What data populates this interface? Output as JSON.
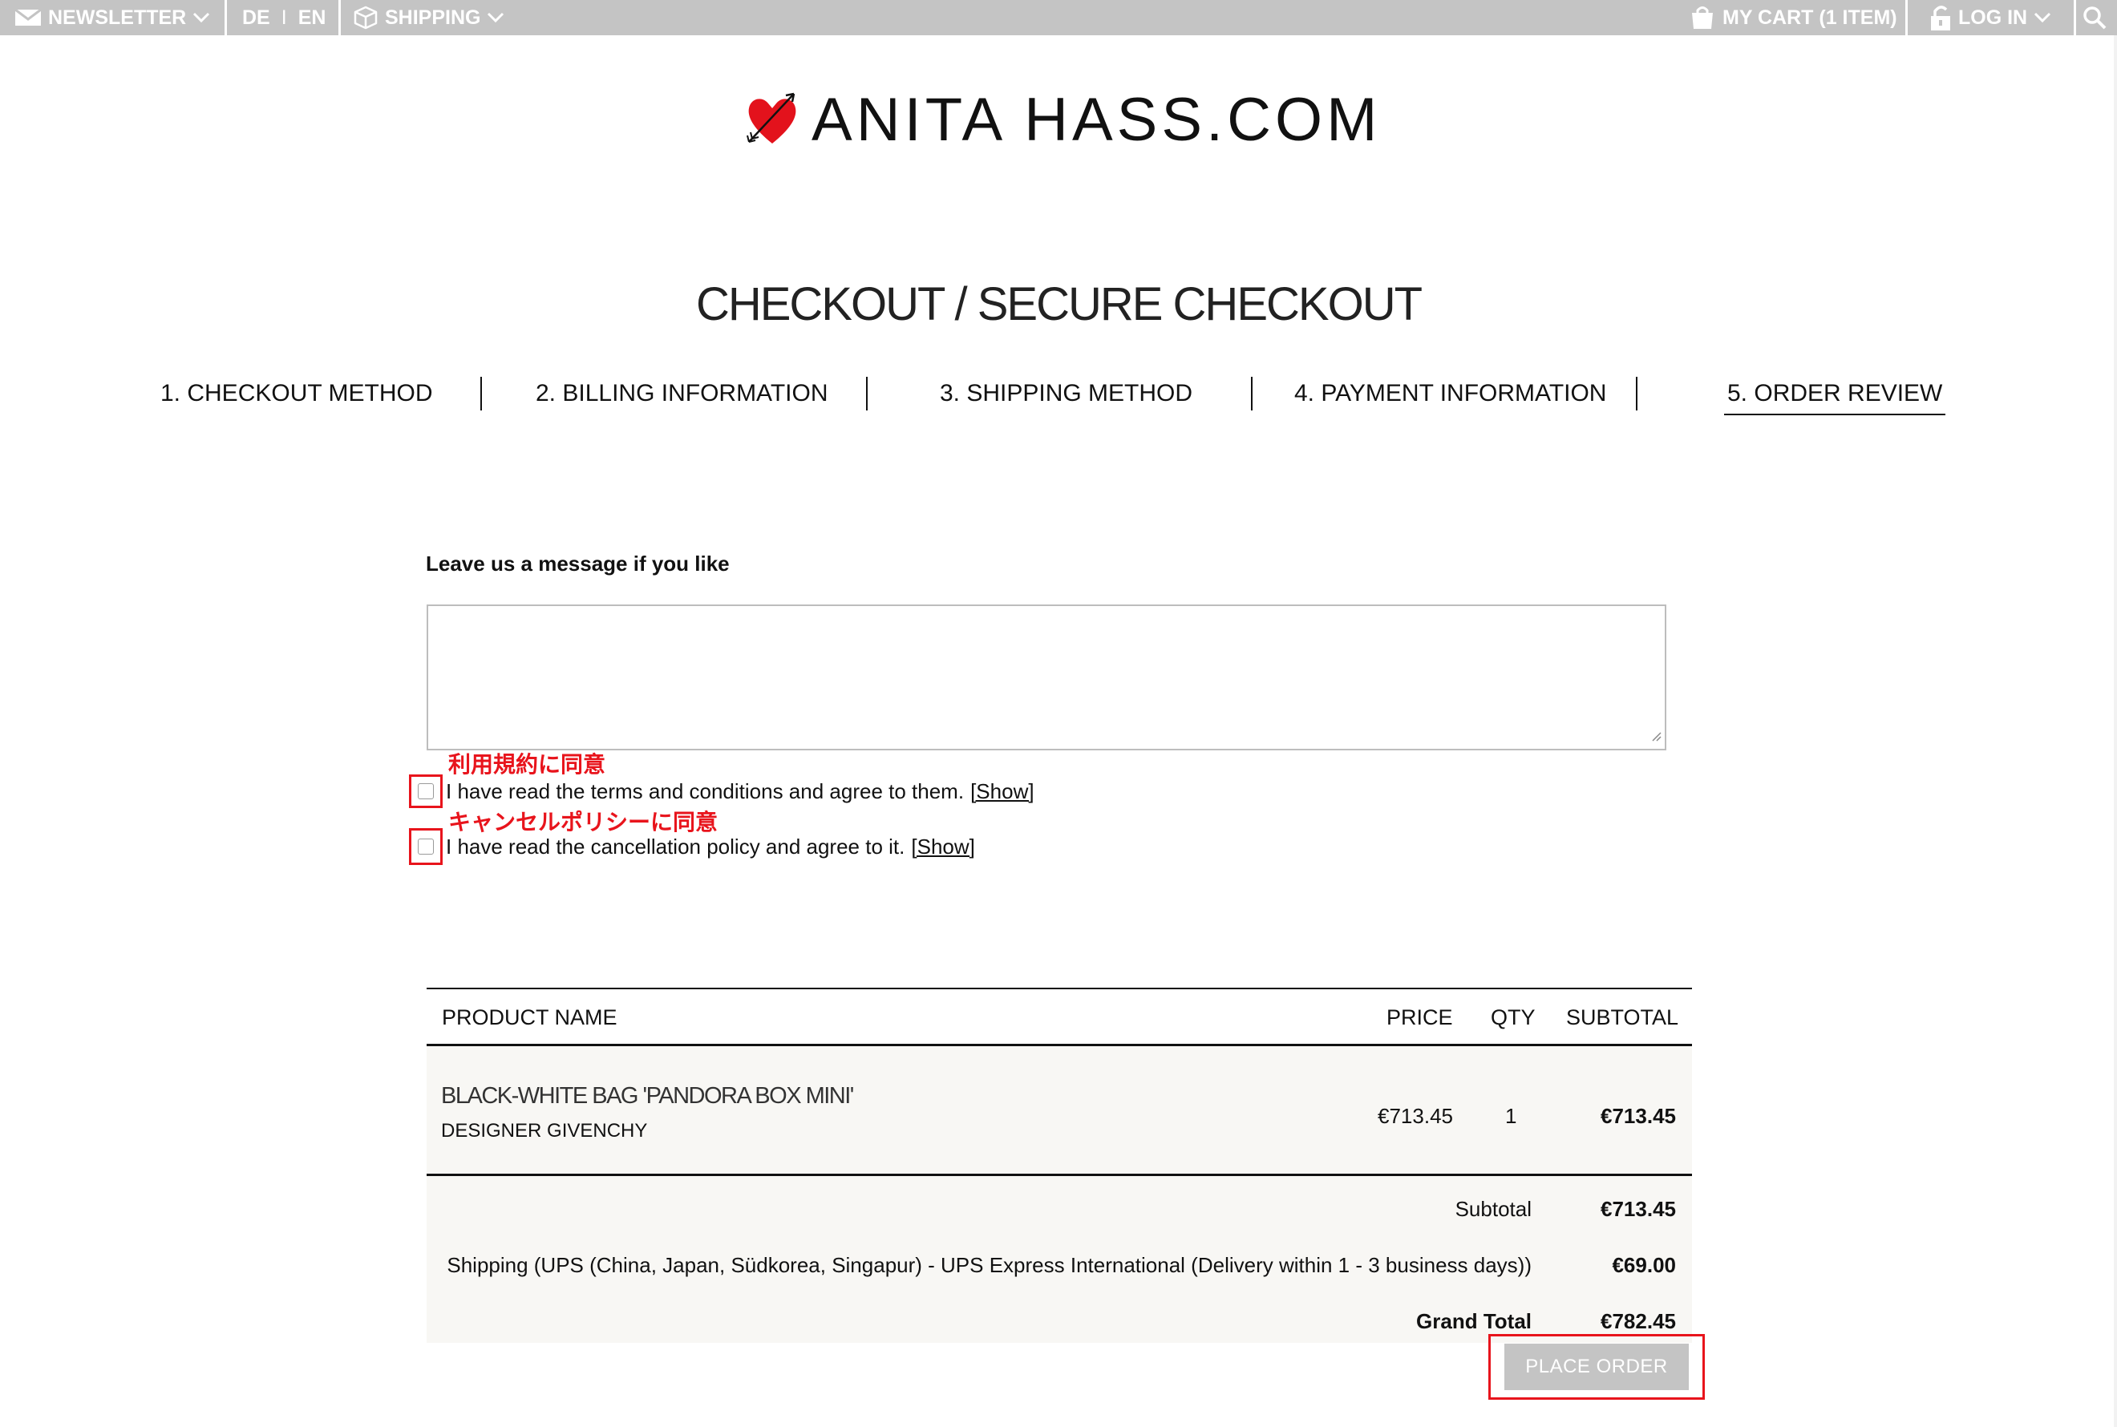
{
  "topbar": {
    "newsletter": "NEWSLETTER",
    "lang_de": "DE",
    "lang_divider": "I",
    "lang_en": "EN",
    "shipping": "SHIPPING",
    "cart": "MY CART (1 ITEM)",
    "login": "LOG IN"
  },
  "logo": {
    "text": "ANITA HASS.COM"
  },
  "page_title": "CHECKOUT / SECURE CHECKOUT",
  "steps": [
    {
      "label": "1. CHECKOUT METHOD"
    },
    {
      "label": "2. BILLING INFORMATION"
    },
    {
      "label": "3. SHIPPING METHOD"
    },
    {
      "label": "4. PAYMENT INFORMATION"
    },
    {
      "label": "5. ORDER REVIEW",
      "active": true
    }
  ],
  "message": {
    "label": "Leave us a message if you like",
    "value": ""
  },
  "agreements": [
    {
      "annotation": "利用規約に同意",
      "text": "I have read the terms and conditions and agree to them.",
      "link": "[Show]",
      "checked": false
    },
    {
      "annotation": "キャンセルポリシーに同意",
      "text": "I have read the cancellation policy and agree to it.",
      "link": "[Show]",
      "checked": false
    }
  ],
  "table": {
    "headers": {
      "product": "PRODUCT NAME",
      "price": "PRICE",
      "qty": "QTY",
      "subtotal": "SUBTOTAL"
    },
    "item": {
      "name": "BLACK-WHITE BAG 'PANDORA BOX MINI'",
      "designer": "DESIGNER  GIVENCHY",
      "price": "€713.45",
      "qty": "1",
      "subtotal": "€713.45"
    },
    "totals": [
      {
        "label": "Subtotal",
        "value": "€713.45"
      },
      {
        "label": "Shipping (UPS (China, Japan, Südkorea, Singapur) - UPS Express International (Delivery within 1 - 3 business days))",
        "value": "€69.00"
      },
      {
        "label": "Grand Total",
        "value": "€782.45"
      }
    ]
  },
  "place_order": "PLACE ORDER",
  "colors": {
    "topbar_bg": "#c4c4c4",
    "annotation_red": "#e8141c",
    "heart_red": "#e3121c",
    "row_bg": "#f8f7f4",
    "button_bg": "#c4c4c4"
  },
  "icons": [
    "envelope-icon",
    "box-icon",
    "chevron-down-icon",
    "bag-icon",
    "lock-icon",
    "search-icon",
    "heart-arrow-logo-icon",
    "resize-grip-icon"
  ]
}
